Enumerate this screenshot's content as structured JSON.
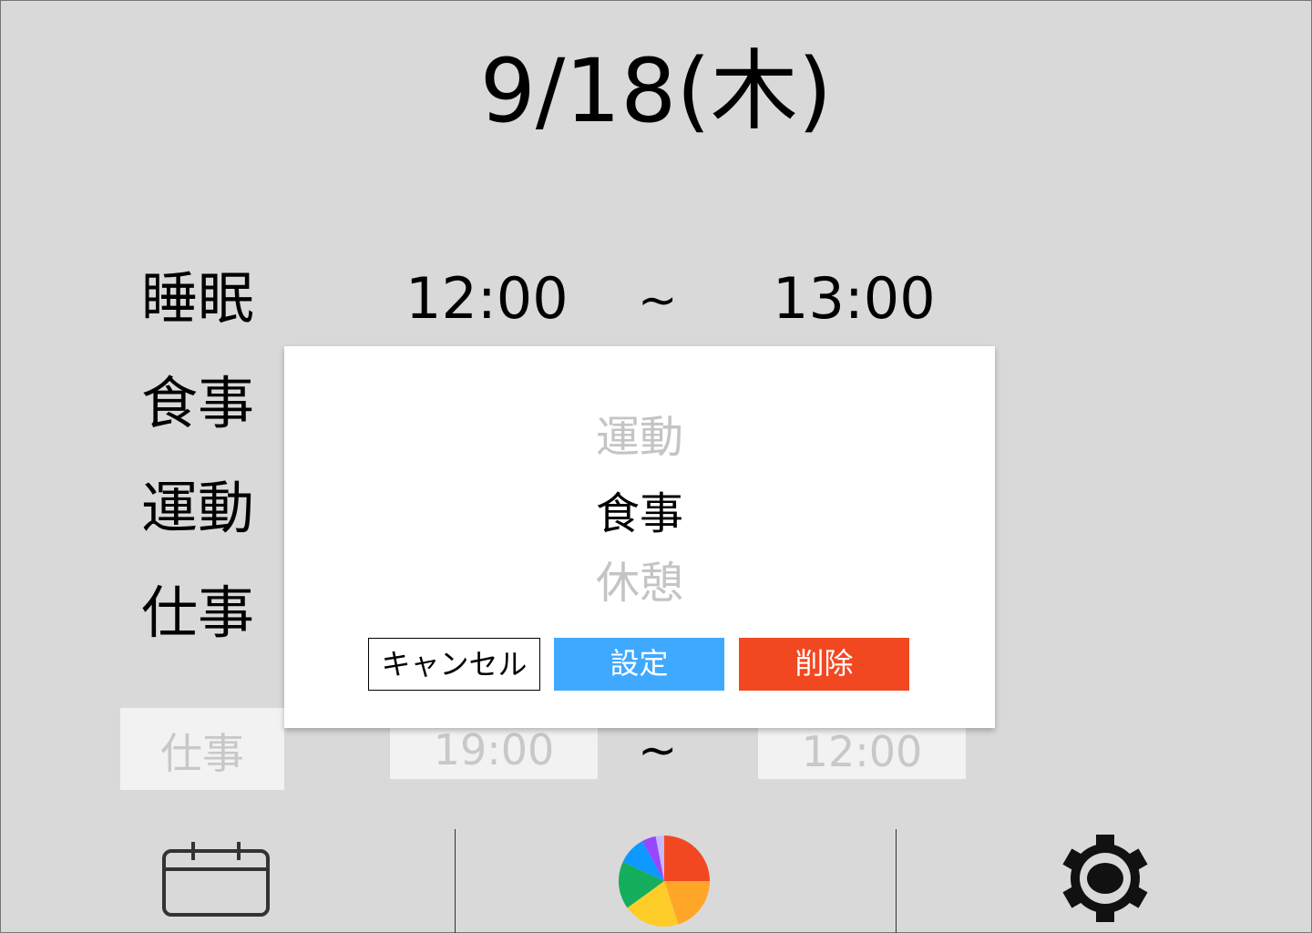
{
  "header": {
    "date": "9/18(木)"
  },
  "entries": [
    {
      "label": "睡眠",
      "start": "12:00",
      "tilde": "~",
      "end": "13:00"
    },
    {
      "label": "食事"
    },
    {
      "label": "運動"
    },
    {
      "label": "仕事"
    }
  ],
  "edit_row": {
    "category": "仕事",
    "start": "19:00",
    "tilde": "~",
    "end": "12:00"
  },
  "modal": {
    "options": [
      "運動",
      "食事",
      "休憩"
    ],
    "selected": "食事",
    "cancel_label": "キャンセル",
    "set_label": "設定",
    "delete_label": "削除"
  },
  "nav": {
    "items": [
      "calendar-icon",
      "pie-chart-icon",
      "gear-icon"
    ]
  },
  "colors": {
    "background": "#d9d9d9",
    "set_button": "#3fa9ff",
    "delete_button": "#f24822",
    "pie": [
      "#f24822",
      "#ffa629",
      "#ffcd29",
      "#14ae5c",
      "#0d99ff",
      "#9747ff",
      "#c7b9ff"
    ]
  }
}
